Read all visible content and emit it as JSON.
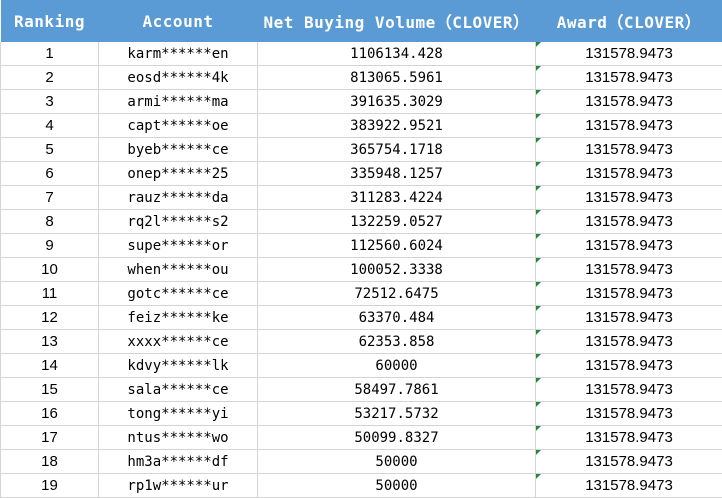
{
  "table": {
    "headers": {
      "ranking": "Ranking",
      "account": "Account",
      "net_buying_volume": "Net Buying Volume（CLOVER）",
      "award": "Award（CLOVER）"
    },
    "rows": [
      {
        "rank": "1",
        "account": "karm******en",
        "volume": "1106134.428",
        "award": "131578.9473"
      },
      {
        "rank": "2",
        "account": "eosd******4k",
        "volume": "813065.5961",
        "award": "131578.9473"
      },
      {
        "rank": "3",
        "account": "armi******ma",
        "volume": "391635.3029",
        "award": "131578.9473"
      },
      {
        "rank": "4",
        "account": "capt******oe",
        "volume": "383922.9521",
        "award": "131578.9473"
      },
      {
        "rank": "5",
        "account": "byeb******ce",
        "volume": "365754.1718",
        "award": "131578.9473"
      },
      {
        "rank": "6",
        "account": "onep******25",
        "volume": "335948.1257",
        "award": "131578.9473"
      },
      {
        "rank": "7",
        "account": "rauz******da",
        "volume": "311283.4224",
        "award": "131578.9473"
      },
      {
        "rank": "8",
        "account": "rq2l******s2",
        "volume": "132259.0527",
        "award": "131578.9473"
      },
      {
        "rank": "9",
        "account": "supe******or",
        "volume": "112560.6024",
        "award": "131578.9473"
      },
      {
        "rank": "10",
        "account": "when******ou",
        "volume": "100052.3338",
        "award": "131578.9473"
      },
      {
        "rank": "11",
        "account": "gotc******ce",
        "volume": "72512.6475",
        "award": "131578.9473"
      },
      {
        "rank": "12",
        "account": "feiz******ke",
        "volume": "63370.484",
        "award": "131578.9473"
      },
      {
        "rank": "13",
        "account": "xxxx******ce",
        "volume": "62353.858",
        "award": "131578.9473"
      },
      {
        "rank": "14",
        "account": "kdvy******lk",
        "volume": "60000",
        "award": "131578.9473"
      },
      {
        "rank": "15",
        "account": "sala******ce",
        "volume": "58497.7861",
        "award": "131578.9473"
      },
      {
        "rank": "16",
        "account": "tong******yi",
        "volume": "53217.5732",
        "award": "131578.9473"
      },
      {
        "rank": "17",
        "account": "ntus******wo",
        "volume": "50099.8327",
        "award": "131578.9473"
      },
      {
        "rank": "18",
        "account": "hm3a******df",
        "volume": "50000",
        "award": "131578.9473"
      },
      {
        "rank": "19",
        "account": "rp1w******ur",
        "volume": "50000",
        "award": "131578.9473"
      }
    ]
  }
}
